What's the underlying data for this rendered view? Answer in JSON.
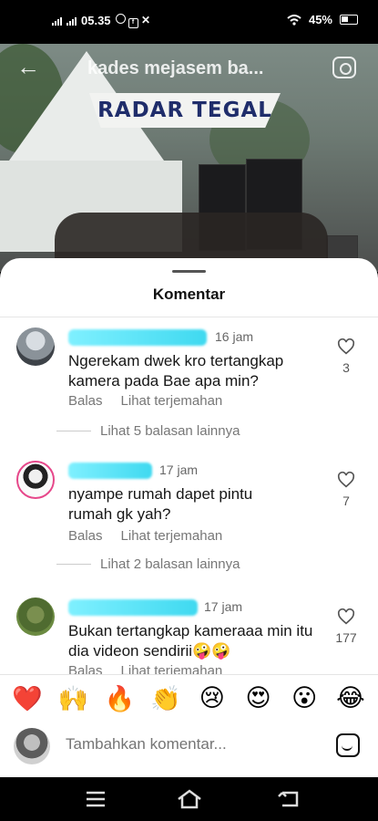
{
  "status_bar": {
    "time": "05.35",
    "app_icons": [
      "whatsapp-icon",
      "facebook-icon",
      "x-icon"
    ],
    "battery": "45%"
  },
  "video": {
    "title": "kades mejasem ba...",
    "banner_text": "RADAR TEGAL"
  },
  "sheet": {
    "title": "Komentar"
  },
  "comments": [
    {
      "time": "16 jam",
      "text": "Ngerekam dwek kro tertangkap kamera pada Bae apa min?",
      "reply_label": "Balas",
      "translate_label": "Lihat terjemahan",
      "likes": "3",
      "more_replies": "Lihat 5 balasan lainnya"
    },
    {
      "time": "17 jam",
      "text": "nyampe rumah dapet pintu rumah gk yah?",
      "reply_label": "Balas",
      "translate_label": "Lihat terjemahan",
      "likes": "7",
      "more_replies": "Lihat 2 balasan lainnya"
    },
    {
      "time": "17 jam",
      "text": "Bukan tertangkap kameraaa min itu dia videon sendirii🤪🤪",
      "reply_label": "Balas",
      "translate_label": "Lihat terjemahan",
      "likes": "177"
    }
  ],
  "emoji_bar": {
    "emojis": [
      "❤️",
      "🙌",
      "🔥",
      "👏",
      "😢",
      "😍",
      "😮",
      "😂"
    ]
  },
  "comment_input": {
    "placeholder": "Tambahkan komentar..."
  },
  "colors": {
    "accent_heart": "#e0262f",
    "username_redaction": "#3fd9f0"
  }
}
